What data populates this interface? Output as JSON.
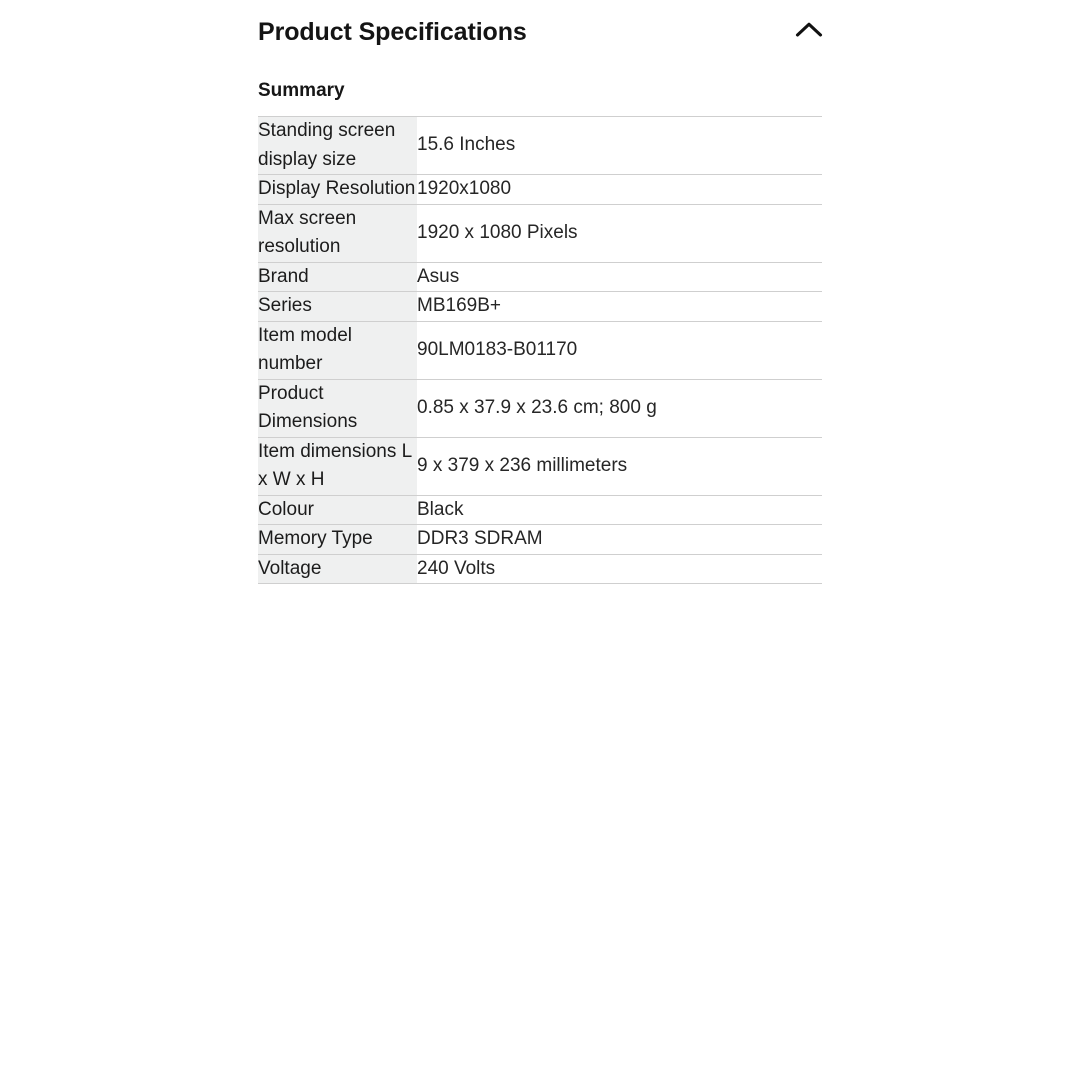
{
  "section": {
    "title": "Product Specifications",
    "collapse_icon": "chevron-up-icon",
    "subheading": "Summary"
  },
  "table": {
    "rows": [
      {
        "label": "Standing screen display size",
        "value": "15.6 Inches"
      },
      {
        "label": "Display Resolution",
        "value": "1920x1080"
      },
      {
        "label": "Max screen resolution",
        "value": "1920 x 1080 Pixels"
      },
      {
        "label": "Brand",
        "value": "Asus"
      },
      {
        "label": "Series",
        "value": "MB169B+"
      },
      {
        "label": "Item model number",
        "value": "90LM0183-B01170"
      },
      {
        "label": "Product Dimensions",
        "value": "0.85 x 37.9 x 23.6 cm; 800 g"
      },
      {
        "label": "Item dimensions L x W x H",
        "value": "9 x 379 x 236 millimeters"
      },
      {
        "label": "Colour",
        "value": "Black"
      },
      {
        "label": "Memory Type",
        "value": "DDR3 SDRAM"
      },
      {
        "label": "Voltage",
        "value": "240 Volts"
      }
    ]
  },
  "colors": {
    "label_cell_bg": "#eff0f0",
    "value_cell_bg": "#ffffff",
    "rule": "#cfcfcf",
    "heading_text": "#141414",
    "body_text": "#262626",
    "page_bg": "#ffffff"
  }
}
